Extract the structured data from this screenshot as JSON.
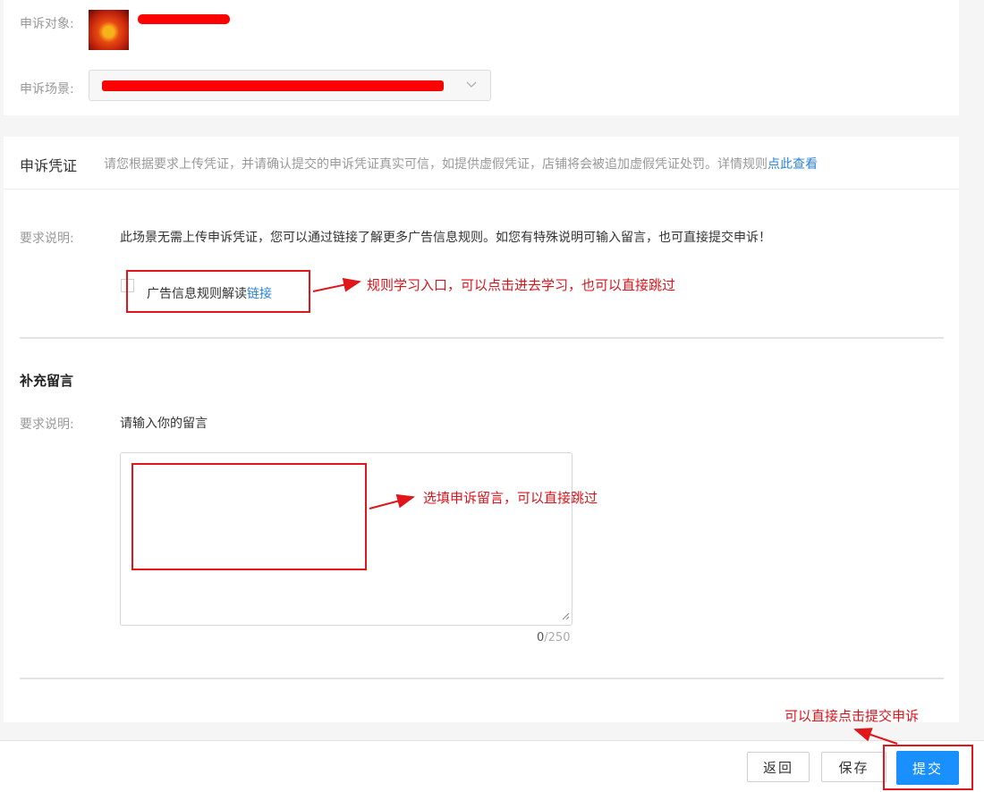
{
  "target": {
    "label": "申诉对象:"
  },
  "scene": {
    "label": "申诉场景:"
  },
  "evidence": {
    "title": "申诉凭证",
    "desc": "请您根据要求上传凭证，并请确认提交的申诉凭证真实可信，如提供虚假凭证，店铺将会被追加虚假凭证处罚。详情规则",
    "link": "点此查看",
    "req_label": "要求说明:",
    "req_text": "此场景无需上传申诉凭证，您可以通过链接了解更多广告信息规则。如您有特殊说明可输入留言，也可直接提交申诉！",
    "rule_text": "广告信息规则解读",
    "rule_link": "链接"
  },
  "message": {
    "title": "补充留言",
    "req_label": "要求说明:",
    "req_text": "请输入你的留言",
    "count_current": "0",
    "count_max": "/250"
  },
  "annotations": {
    "rule": "规则学习入口，可以点击进去学习，也可以直接跳过",
    "message": "选填申诉留言，可以直接跳过",
    "submit": "可以直接点击提交申诉"
  },
  "footer": {
    "back": "返回",
    "save": "保存",
    "submit": "提交"
  },
  "colors": {
    "accent": "#1a90ff",
    "annotation": "#e0161a",
    "link": "#2b83d9"
  }
}
